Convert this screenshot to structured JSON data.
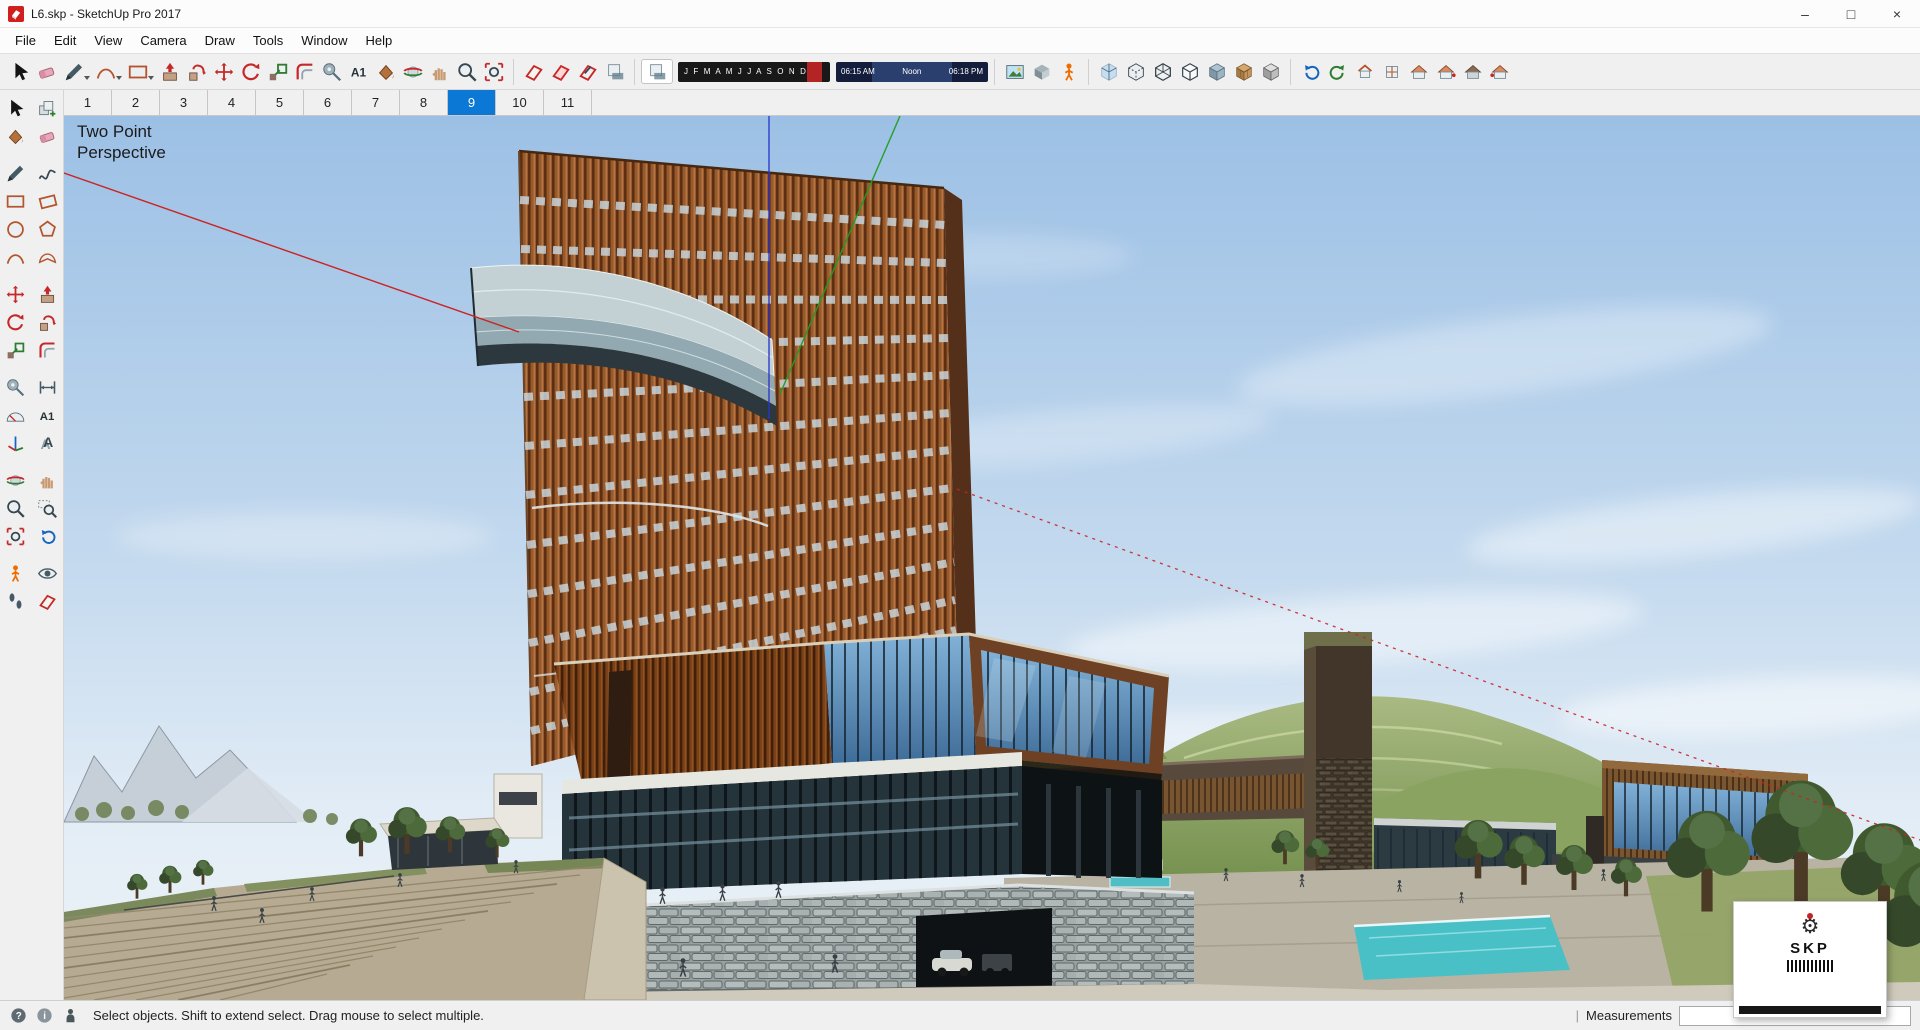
{
  "window": {
    "title": "L6.skp - SketchUp Pro 2017",
    "controls": {
      "minimize": "–",
      "maximize": "□",
      "close": "×"
    }
  },
  "menu": {
    "items": [
      "File",
      "Edit",
      "View",
      "Camera",
      "Draw",
      "Tools",
      "Window",
      "Help"
    ]
  },
  "toolbar": {
    "dropdown_tools": [
      "line",
      "arc",
      "rectangle"
    ],
    "groups": [
      {
        "name": "principal",
        "icons": [
          "select",
          "eraser",
          "line",
          "arc",
          "rectangle",
          "push-pull",
          "follow-me",
          "move",
          "rotate",
          "scale",
          "offset",
          "tape-measure",
          "text",
          "paint-bucket",
          "orbit",
          "pan",
          "zoom",
          "zoom-extents"
        ]
      },
      {
        "name": "section",
        "icons": [
          "section-plane",
          "display-section-planes",
          "display-section-cuts",
          "shadows-dialog"
        ]
      },
      {
        "name": "camera",
        "icons": [
          "match-photo",
          "materials",
          "position-camera"
        ]
      },
      {
        "name": "styles",
        "icons": [
          "x-ray",
          "back-edges",
          "wireframe",
          "hidden-line",
          "shaded",
          "shaded-with-textures",
          "monochrome"
        ]
      },
      {
        "name": "views",
        "icons": [
          "previous-view",
          "next-view",
          "iso-view",
          "top-view",
          "front-view",
          "right-view",
          "back-view",
          "left-view"
        ]
      }
    ],
    "shadow": {
      "toggle_icon": "shadows-toggle",
      "months": "J F M A M J J A S O N D",
      "time_start": "06:15 AM",
      "time_mid": "Noon",
      "time_end": "06:18 PM"
    }
  },
  "tabs": {
    "items": [
      "1",
      "2",
      "3",
      "4",
      "5",
      "6",
      "7",
      "8",
      "9",
      "10",
      "11"
    ],
    "active": "9",
    "active_index": 8
  },
  "tool_palette": {
    "rows": [
      [
        "select",
        "make-component"
      ],
      [
        "paint-bucket",
        "eraser"
      ],
      [
        "line",
        "freehand"
      ],
      [
        "rectangle",
        "rotated-rectangle"
      ],
      [
        "circle",
        "polygon"
      ],
      [
        "arc",
        "pie"
      ],
      [
        "move",
        "push-pull"
      ],
      [
        "rotate",
        "follow-me"
      ],
      [
        "scale",
        "offset"
      ],
      [
        "tape-measure",
        "dimension"
      ],
      [
        "protractor",
        "text"
      ],
      [
        "axes",
        "3d-text"
      ],
      [
        "orbit",
        "pan"
      ],
      [
        "zoom",
        "zoom-window"
      ],
      [
        "zoom-extents",
        "previous-view"
      ],
      [
        "position-camera",
        "look-around"
      ],
      [
        "walk",
        "section-plane"
      ]
    ],
    "gaps_after_rows": [
      1,
      5,
      8,
      11,
      14
    ]
  },
  "viewport": {
    "label_line1": "Two Point",
    "label_line2": "Perspective"
  },
  "watermark": {
    "text": "SKP",
    "gear_glyph": "⚙"
  },
  "statusbar": {
    "icons": [
      "help",
      "info",
      "geo-person"
    ],
    "message": "Select objects. Shift to extend select. Drag mouse to select multiple.",
    "separator": "|",
    "measurements_label": "Measurements",
    "measurements_value": ""
  },
  "colors": {
    "accent_tab": "#0a78d4",
    "axis_red": "#cc2222",
    "axis_green": "#1f9e1f",
    "axis_blue": "#2a35cc",
    "sky_top": "#9cc0e5",
    "month_strip_red": "#b32424",
    "tower_wood": "#98592c",
    "glass_blue": "#3f6d99"
  }
}
